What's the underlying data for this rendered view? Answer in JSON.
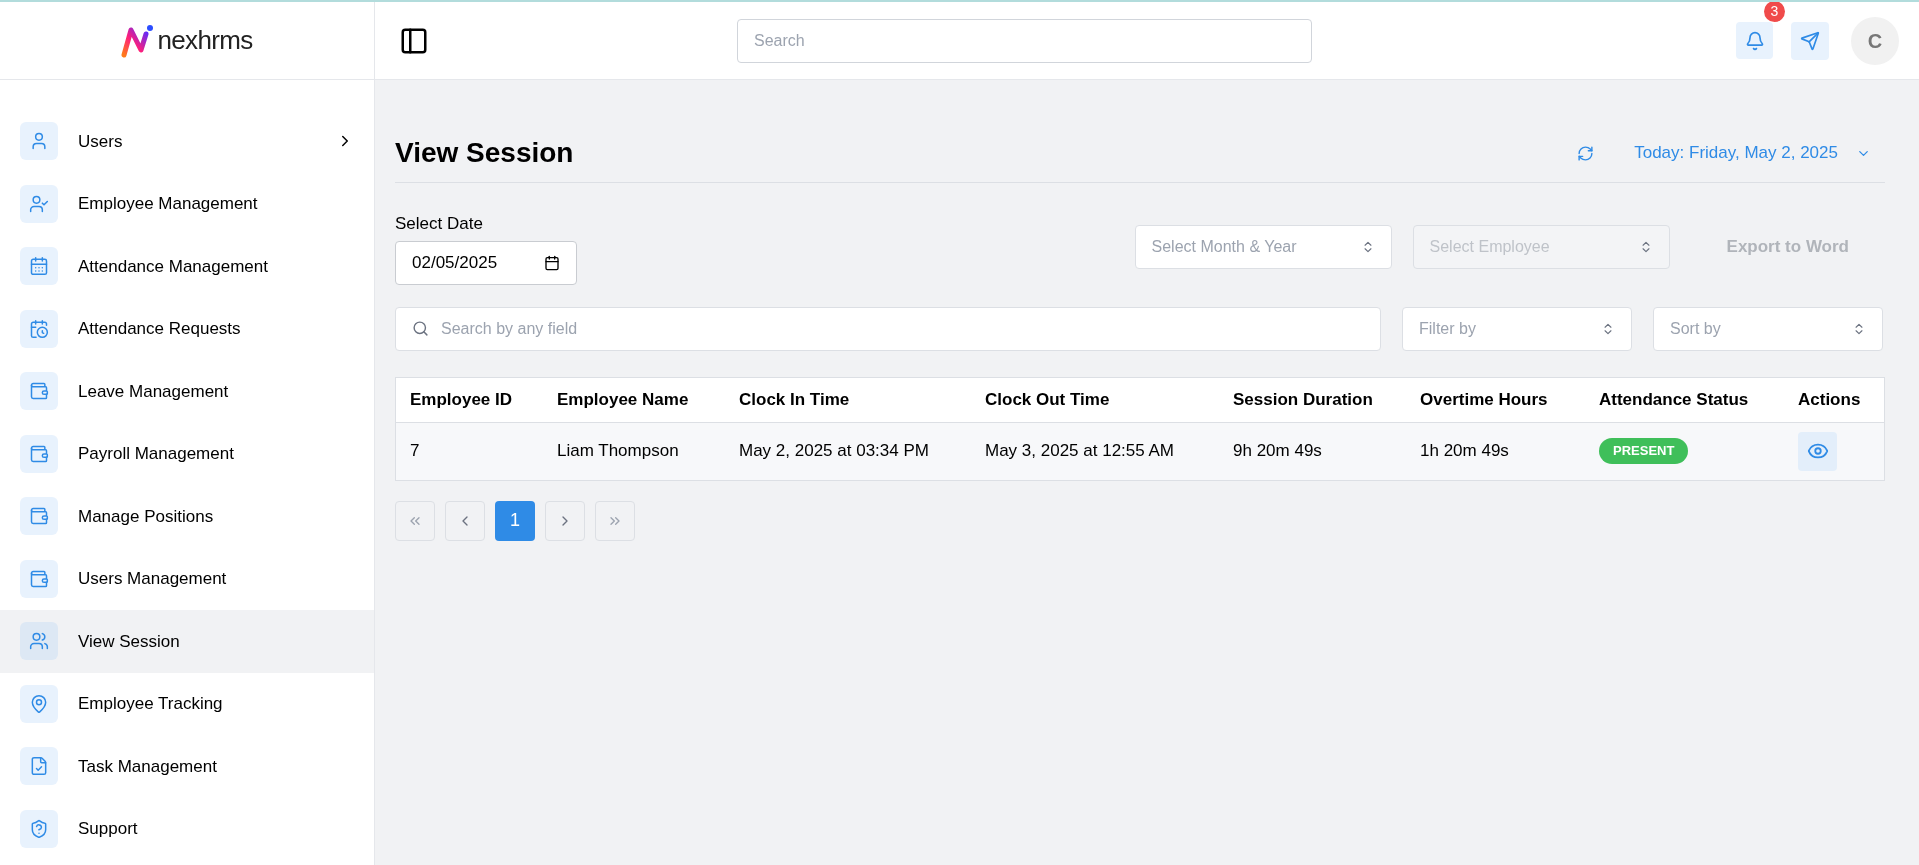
{
  "brand": {
    "name": "nexhrms"
  },
  "sidebar": {
    "items": [
      {
        "label": "Users",
        "selected": false,
        "expanded": false
      },
      {
        "label": "Employee Management",
        "selected": false
      },
      {
        "label": "Attendance Management",
        "selected": false
      },
      {
        "label": "Attendance Requests",
        "selected": false
      },
      {
        "label": "Leave Management",
        "selected": false
      },
      {
        "label": "Payroll Management",
        "selected": false
      },
      {
        "label": "Manage Positions",
        "selected": false
      },
      {
        "label": "Users Management",
        "selected": false
      },
      {
        "label": "View Session",
        "selected": true
      },
      {
        "label": "Employee Tracking",
        "selected": false
      },
      {
        "label": "Task Management",
        "selected": false
      },
      {
        "label": "Support",
        "selected": false
      }
    ]
  },
  "header": {
    "search": {
      "placeholder": "Search"
    },
    "notifications": {
      "count": "3"
    },
    "avatar": {
      "initial": "C"
    }
  },
  "page": {
    "title": "View Session",
    "date_menu": "Today: Friday, May 2, 2025"
  },
  "filters": {
    "date_label": "Select Date",
    "date_value": "02/05/2025",
    "month_select": {
      "placeholder": "Select Month & Year",
      "disabled": false
    },
    "employee_select": {
      "placeholder": "Select Employee",
      "disabled": true
    },
    "export_button": {
      "label": "Export to Word",
      "disabled": true
    },
    "search": {
      "placeholder": "Search by any field"
    },
    "filter_by": {
      "placeholder": "Filter by"
    },
    "sort_by": {
      "placeholder": "Sort by"
    }
  },
  "table": {
    "columns": [
      "Employee ID",
      "Employee Name",
      "Clock In Time",
      "Clock Out Time",
      "Session Duration",
      "Overtime Hours",
      "Attendance Status",
      "Actions"
    ],
    "rows": [
      {
        "cells": [
          "7",
          "Liam Thompson",
          "May 2, 2025 at 03:34 PM",
          "May 3, 2025 at 12:55 AM",
          "9h 20m 49s",
          "1h 20m 49s"
        ],
        "status": {
          "label": "PRESENT",
          "color": "#3fbf5a"
        }
      }
    ]
  },
  "pagination": {
    "pages": [
      {
        "label": "1",
        "selected": true
      }
    ]
  }
}
